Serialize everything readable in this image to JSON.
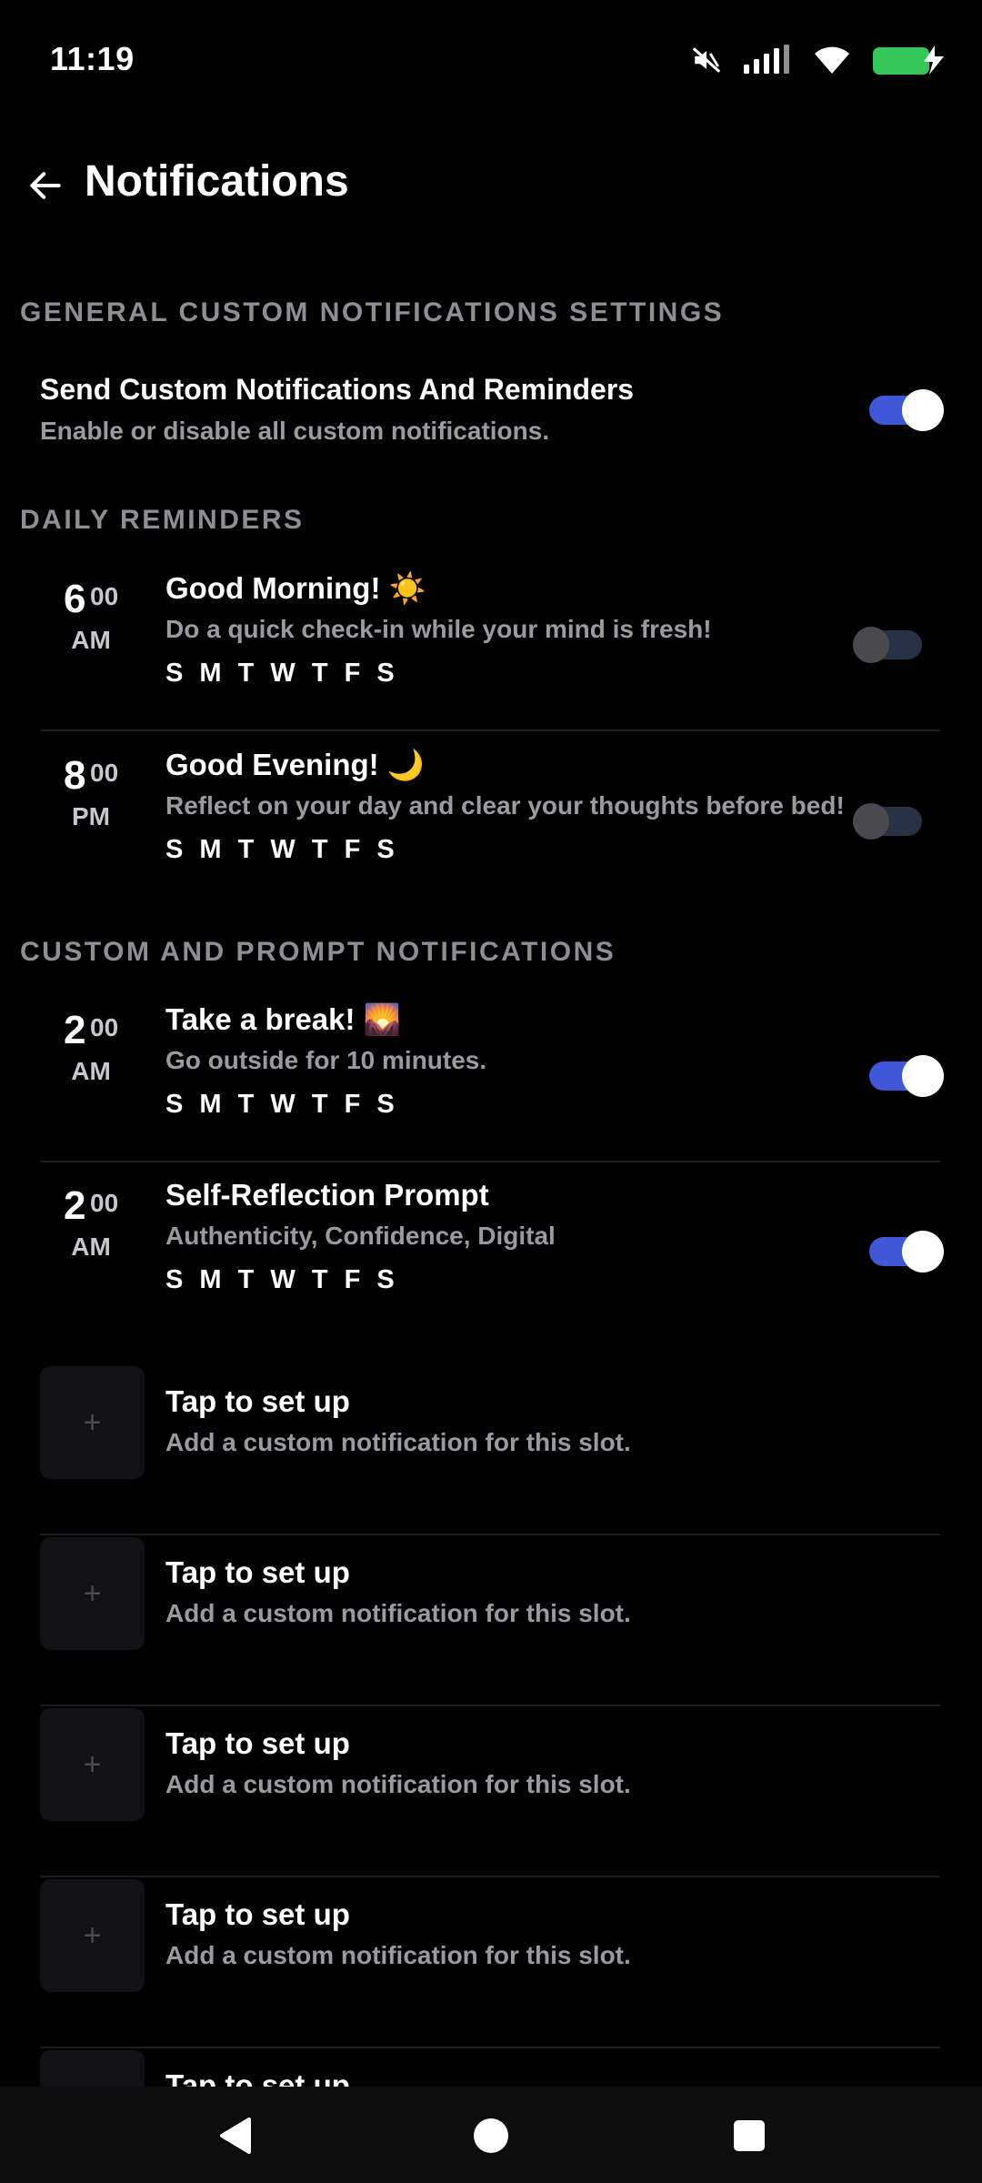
{
  "status_bar": {
    "time": "11:19",
    "icons": [
      "mute-icon",
      "signal-icon",
      "wifi-icon",
      "battery-charging-icon"
    ],
    "battery_color": "#34c759"
  },
  "header": {
    "title": "Notifications"
  },
  "general": {
    "heading": "GENERAL CUSTOM NOTIFICATIONS SETTINGS",
    "title": "Send Custom Notifications And Reminders",
    "subtitle": "Enable or disable all custom notifications.",
    "enabled": true
  },
  "daily": {
    "heading": "DAILY REMINDERS",
    "items": [
      {
        "hour": "6",
        "minute": "00",
        "ampm": "AM",
        "title": "Good Morning! ☀️",
        "subtitle": "Do a quick check-in while your mind is fresh!",
        "days": "S M T W T F S",
        "enabled": false
      },
      {
        "hour": "8",
        "minute": "00",
        "ampm": "PM",
        "title": "Good Evening! 🌙",
        "subtitle": "Reflect on your day and clear your thoughts before bed!",
        "days": "S M T W T F S",
        "enabled": false
      }
    ]
  },
  "custom": {
    "heading": "CUSTOM AND PROMPT NOTIFICATIONS",
    "items": [
      {
        "hour": "2",
        "minute": "00",
        "ampm": "AM",
        "title": "Take a break! 🌄",
        "subtitle": "Go outside for 10 minutes.",
        "days": "S M T W T F S",
        "enabled": true
      },
      {
        "hour": "2",
        "minute": "00",
        "ampm": "AM",
        "title": "Self-Reflection Prompt",
        "subtitle": "Authenticity, Confidence, Digital",
        "days": "S M T W T F S",
        "enabled": true
      }
    ],
    "slots": [
      {
        "icon": "+",
        "title": "Tap to set up",
        "subtitle": "Add a custom notification for this slot."
      },
      {
        "icon": "+",
        "title": "Tap to set up",
        "subtitle": "Add a custom notification for this slot."
      },
      {
        "icon": "+",
        "title": "Tap to set up",
        "subtitle": "Add a custom notification for this slot."
      },
      {
        "icon": "+",
        "title": "Tap to set up",
        "subtitle": "Add a custom notification for this slot."
      },
      {
        "icon": "+",
        "title": "Tap to set up",
        "subtitle": ""
      }
    ]
  },
  "colors": {
    "accent": "#3f58d9",
    "background": "#000000",
    "muted_text": "#9a9a9f"
  },
  "nav": {
    "icons": [
      "back-triangle-icon",
      "home-circle-icon",
      "recents-square-icon"
    ]
  }
}
